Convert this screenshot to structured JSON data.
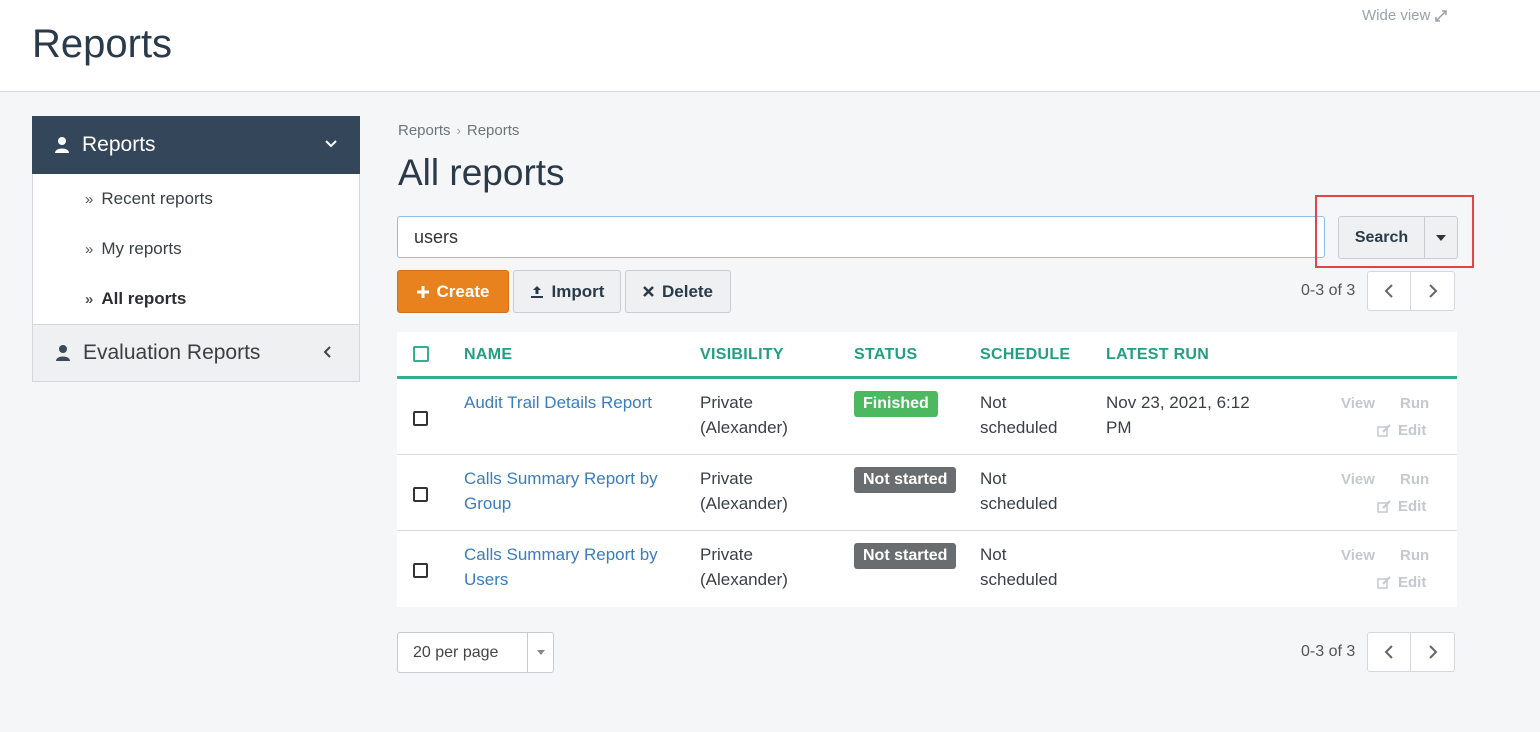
{
  "header": {
    "title": "Reports",
    "wide_view": "Wide view"
  },
  "sidebar": {
    "section_title": "Reports",
    "items": [
      {
        "label": "Recent reports"
      },
      {
        "label": "My reports"
      },
      {
        "label": "All reports",
        "active": true
      }
    ],
    "eval_title": "Evaluation Reports"
  },
  "breadcrumb": [
    "Reports",
    "Reports"
  ],
  "main": {
    "title": "All reports",
    "search_value": "users",
    "search_label": "Search",
    "create_label": "Create",
    "import_label": "Import",
    "delete_label": "Delete",
    "pager_count": "0-3 of 3"
  },
  "table": {
    "columns": [
      "NAME",
      "VISIBILITY",
      "STATUS",
      "SCHEDULE",
      "LATEST RUN"
    ],
    "rows": [
      {
        "name": "Audit Trail Details Report",
        "visibility": "Private (Alexander)",
        "status": "Finished",
        "schedule": "Not scheduled",
        "latest_run": "Nov 23, 2021, 6:12 PM"
      },
      {
        "name": "Calls Summary Report by Group",
        "visibility": "Private (Alexander)",
        "status": "Not started",
        "schedule": "Not scheduled",
        "latest_run": ""
      },
      {
        "name": "Calls Summary Report by Users",
        "visibility": "Private (Alexander)",
        "status": "Not started",
        "schedule": "Not scheduled",
        "latest_run": ""
      }
    ],
    "actions": {
      "view": "View",
      "run": "Run",
      "edit": "Edit"
    }
  },
  "footer": {
    "per_page": "20 per page",
    "pager_count": "0-3 of 3"
  },
  "colors": {
    "accent": "#2fb08e",
    "create": "#e8821e",
    "finished": "#4cb860",
    "not_started": "#6a6d70",
    "sidebar": "#344659",
    "highlight": "#e04646"
  }
}
